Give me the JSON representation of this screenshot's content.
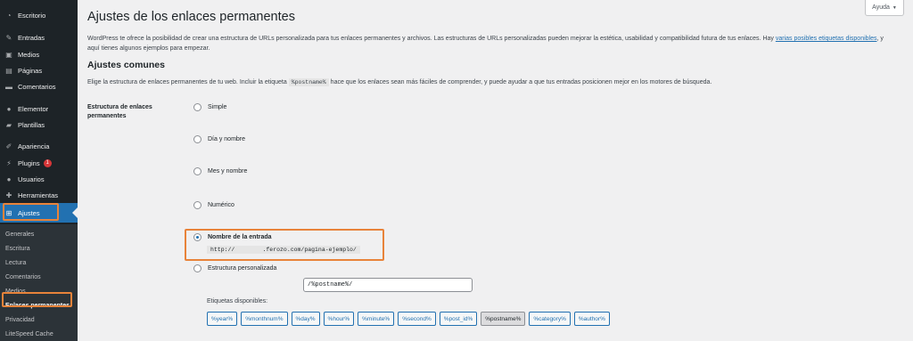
{
  "sidebar": {
    "items": [
      {
        "label": "Escritorio",
        "icon": "dashboard-icon"
      },
      {
        "label": "Entradas",
        "icon": "pin-icon"
      },
      {
        "label": "Medios",
        "icon": "media-icon"
      },
      {
        "label": "Páginas",
        "icon": "pages-icon"
      },
      {
        "label": "Comentarios",
        "icon": "comments-icon"
      },
      {
        "label": "Elementor",
        "icon": "elementor-icon"
      },
      {
        "label": "Plantillas",
        "icon": "folder-icon"
      },
      {
        "label": "Apariencia",
        "icon": "brush-icon"
      },
      {
        "label": "Plugins",
        "icon": "plugin-icon",
        "badge": "1"
      },
      {
        "label": "Usuarios",
        "icon": "user-icon"
      },
      {
        "label": "Herramientas",
        "icon": "wrench-icon"
      },
      {
        "label": "Ajustes",
        "icon": "settings-icon",
        "active": true
      }
    ],
    "submenu": [
      "Generales",
      "Escritura",
      "Lectura",
      "Comentarios",
      "Medios",
      "Enlaces permanentes",
      "Privacidad",
      "LiteSpeed Cache"
    ]
  },
  "header": {
    "help_label": "Ayuda",
    "title": "Ajustes de los enlaces permanentes"
  },
  "intro": {
    "text": "WordPress te ofrece la posibilidad de crear una estructura de URLs personalizada para tus enlaces permanentes y archivos. Las estructuras de URLs personalizadas pueden mejorar la estética, usabilidad y compatibilidad futura de tus enlaces. Hay",
    "link": "varias posibles etiquetas disponibles",
    "text_after": ", y",
    "line2": "aquí tienes algunos ejemplos para empezar."
  },
  "common": {
    "title": "Ajustes comunes",
    "desc_before": "Elige la estructura de enlaces permanentes de tu web. Incluir la etiqueta",
    "desc_code": "%postname%",
    "desc_after": "hace que los enlaces sean más fáciles de comprender, y puede ayudar a que tus entradas posicionen mejor en los motores de búsqueda.",
    "field_label": "Estructura de enlaces permanentes",
    "options": [
      {
        "label": "Simple",
        "checked": false
      },
      {
        "label": "Día y nombre",
        "checked": false
      },
      {
        "label": "Mes y nombre",
        "checked": false
      },
      {
        "label": "Numérico",
        "checked": false
      },
      {
        "label": "Nombre de la entrada",
        "checked": true
      },
      {
        "label": "Estructura personalizada",
        "checked": false
      }
    ],
    "example_url": "http://        .ferozo.com/pagina-ejemplo/",
    "custom_value": "/%postname%/",
    "tags_label": "Etiquetas disponibles:",
    "tags": [
      "%year%",
      "%monthnum%",
      "%day%",
      "%hour%",
      "%minute%",
      "%second%",
      "%post_id%",
      "%postname%",
      "%category%",
      "%author%"
    ],
    "active_tag": "%postname%"
  },
  "colors": {
    "sidebar_bg": "#1d2327",
    "active_bg": "#2271b1",
    "highlight": "#e8833a",
    "badge": "#d63638"
  }
}
